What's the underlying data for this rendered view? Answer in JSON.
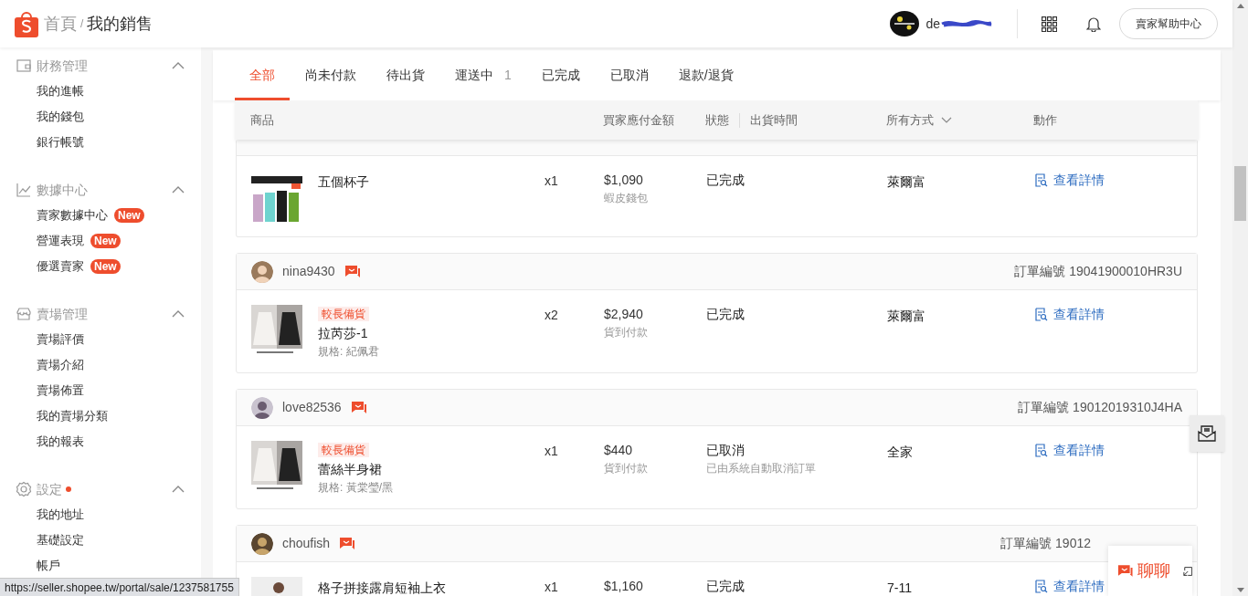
{
  "header": {
    "breadcrumb": [
      "首頁",
      "我的銷售"
    ],
    "separator": "/",
    "username": "de",
    "help_button": "賣家幫助中心"
  },
  "sidebar": [
    {
      "title": "財務管理",
      "dot": false,
      "expanded": true,
      "items": [
        {
          "label": "我的進帳"
        },
        {
          "label": "我的錢包"
        },
        {
          "label": "銀行帳號"
        }
      ]
    },
    {
      "title": "數據中心",
      "dot": false,
      "expanded": true,
      "items": [
        {
          "label": "賣家數據中心",
          "badge": "New"
        },
        {
          "label": "營運表現",
          "badge": "New"
        },
        {
          "label": "優選賣家",
          "badge": "New"
        }
      ]
    },
    {
      "title": "賣場管理",
      "dot": false,
      "expanded": true,
      "items": [
        {
          "label": "賣場評價"
        },
        {
          "label": "賣場介紹"
        },
        {
          "label": "賣場佈置"
        },
        {
          "label": "我的賣場分類"
        },
        {
          "label": "我的報表"
        }
      ]
    },
    {
      "title": "設定",
      "dot": true,
      "expanded": true,
      "items": [
        {
          "label": "我的地址"
        },
        {
          "label": "基礎設定"
        },
        {
          "label": "帳戶"
        }
      ]
    }
  ],
  "tabs": [
    {
      "label": "全部",
      "selected": true
    },
    {
      "label": "尚未付款",
      "selected": false
    },
    {
      "label": "待出貨",
      "selected": false
    },
    {
      "label": "運送中",
      "count": "1",
      "selected": false
    },
    {
      "label": "已完成",
      "selected": false
    },
    {
      "label": "已取消",
      "selected": false
    },
    {
      "label": "退款/退貨",
      "selected": false
    }
  ],
  "columns": {
    "product": "商品",
    "amount": "買家應付金額",
    "status": "狀態",
    "ship_time": "出貨時間",
    "shipping": "所有方式",
    "action": "動作"
  },
  "orders": [
    {
      "items": [
        {
          "name": "五個杯子",
          "qty": "x1",
          "price": "$1,090",
          "payment": "蝦皮錢包",
          "status": "已完成",
          "shipping": "萊爾富",
          "action": "查看詳情"
        }
      ]
    },
    {
      "buyer": "nina9430",
      "order_no": "訂單編號 19041900010HR3U",
      "items": [
        {
          "tag": "較長備貨",
          "name": "拉芮莎-1",
          "spec": "規格: 紀佩君",
          "qty": "x2",
          "price": "$2,940",
          "payment": "貨到付款",
          "status": "已完成",
          "shipping": "萊爾富",
          "action": "查看詳情"
        }
      ]
    },
    {
      "buyer": "love82536",
      "order_no": "訂單編號 19012019310J4HA",
      "items": [
        {
          "tag": "較長備貨",
          "name": "蕾絲半身裙",
          "spec": "規格: 黃棠瑩/黑",
          "qty": "x1",
          "price": "$440",
          "payment": "貨到付款",
          "status": "已取消",
          "status_note": "已由系統自動取消訂單",
          "shipping": "全家",
          "action": "查看詳情"
        }
      ]
    },
    {
      "buyer": "choufish",
      "order_no": "訂單編號 19012",
      "items": [
        {
          "name": "格子拼接露肩短袖上衣",
          "qty": "x1",
          "price": "$1,160",
          "status": "已完成",
          "shipping": "7-11",
          "action": "查看詳情"
        }
      ]
    }
  ],
  "chat": {
    "label": "聊聊"
  },
  "status_url": "https://seller.shopee.tw/portal/sale/1237581755"
}
